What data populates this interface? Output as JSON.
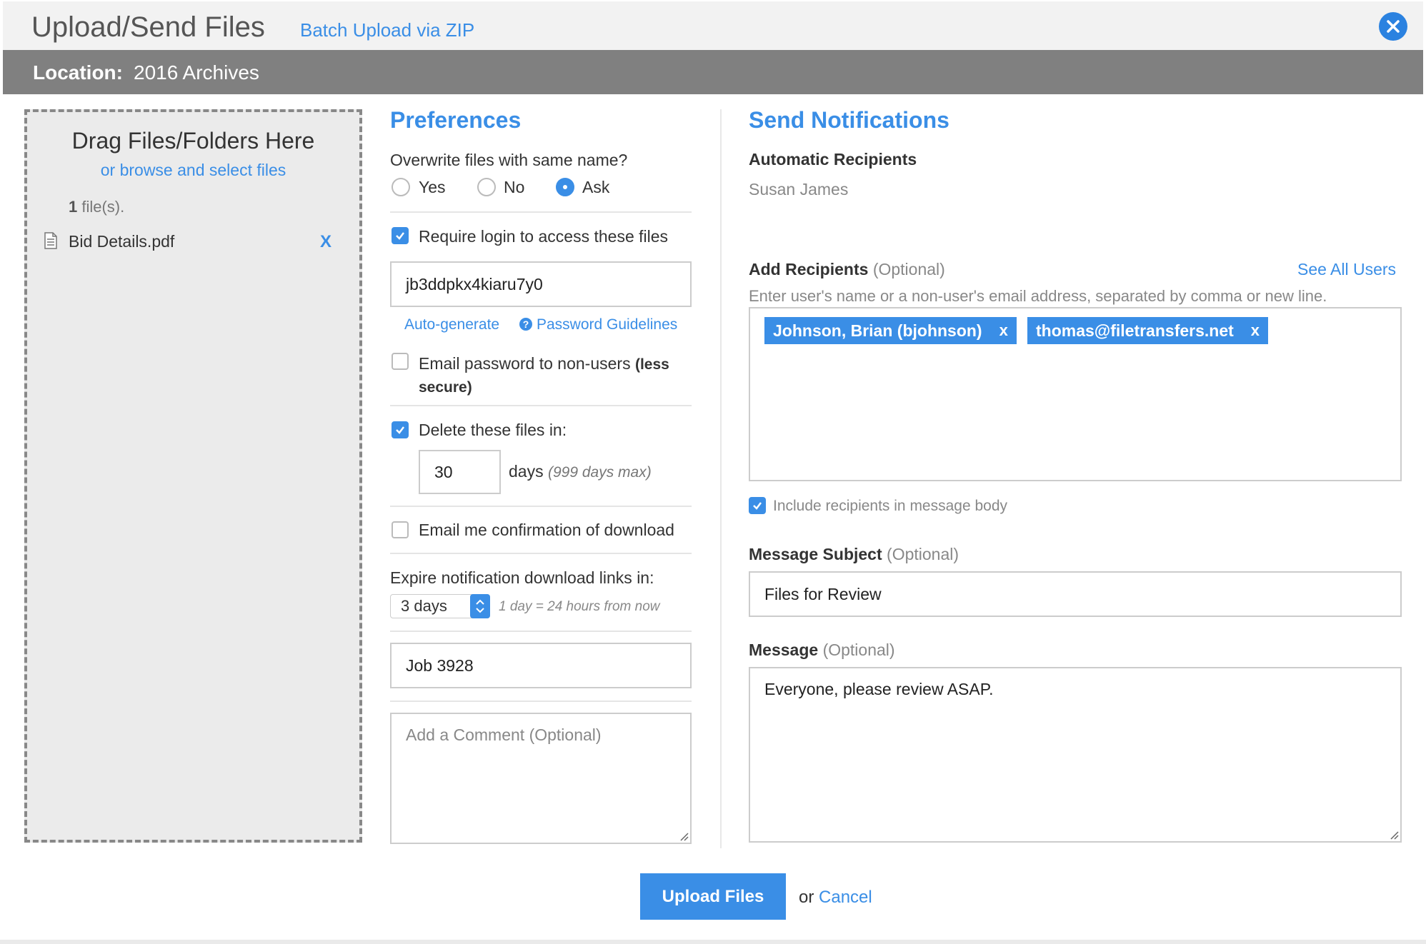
{
  "header": {
    "title": "Upload/Send Files",
    "batch_link": "Batch Upload via ZIP",
    "close_icon": "close-icon"
  },
  "location": {
    "label": "Location:",
    "value": "2016 Archives"
  },
  "dropzone": {
    "title": "Drag Files/Folders Here",
    "browse_link": "or browse and select files",
    "count_number": "1",
    "count_suffix": " file(s).",
    "files": [
      {
        "name": "Bid Details.pdf",
        "remove": "X",
        "icon": "document-icon"
      }
    ]
  },
  "preferences": {
    "heading": "Preferences",
    "overwrite_question": "Overwrite files with same name?",
    "overwrite_options": [
      "Yes",
      "No",
      "Ask"
    ],
    "overwrite_selected": "Ask",
    "require_login_label": "Require login to access these files",
    "require_login_checked": true,
    "password_value": "jb3ddpkx4kiaru7y0",
    "auto_generate": "Auto-generate",
    "password_guidelines": "Password Guidelines",
    "email_password_label": "Email password to non-users",
    "email_password_bold": "(less",
    "email_password_bold_2": "secure)",
    "email_password_checked": false,
    "delete_label": "Delete these files in:",
    "delete_checked": true,
    "delete_days_value": "30",
    "days_label": "days",
    "days_max": "(999 days max)",
    "email_confirmation_label": "Email me confirmation of download",
    "email_confirmation_checked": false,
    "expire_label": "Expire notification download links in:",
    "expire_selected": "3 days",
    "expire_hint": "1 day = 24 hours from now",
    "reference_value": "Job 3928",
    "comment_placeholder": "Add a Comment (Optional)"
  },
  "notifications": {
    "heading": "Send Notifications",
    "automatic_heading": "Automatic Recipients",
    "automatic_recipient": "Susan James",
    "add_recipients_label": "Add Recipients",
    "optional": "(Optional)",
    "see_all_users": "See All Users",
    "add_recipients_hint": "Enter user's name or a non-user's email address, separated by comma or new line.",
    "recipients": [
      {
        "label": "Johnson, Brian (bjohnson)",
        "remove": "x"
      },
      {
        "label": "thomas@filetransfers.net",
        "remove": "x"
      }
    ],
    "include_label": "Include recipients in message body",
    "include_checked": true,
    "subject_label": "Message Subject",
    "subject_value": "Files for Review",
    "message_label": "Message",
    "message_value": "Everyone, please review ASAP."
  },
  "footer": {
    "upload_button": "Upload Files",
    "or": "or",
    "cancel": "Cancel"
  },
  "colors": {
    "accent": "#3a8ee6",
    "location_bar": "#808080",
    "dropzone_bg": "#ebebeb"
  }
}
